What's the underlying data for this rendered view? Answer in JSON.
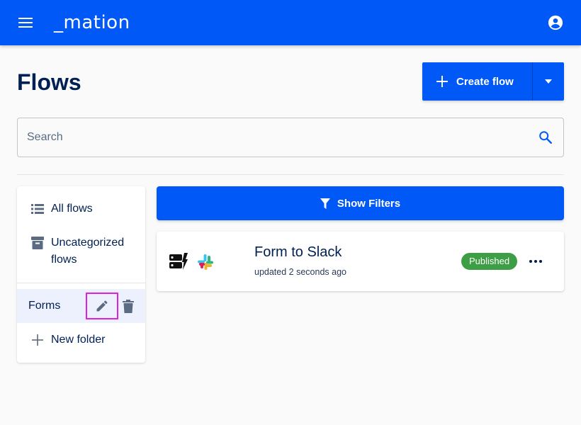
{
  "appbar": {
    "logo": "_mation"
  },
  "page": {
    "title": "Flows"
  },
  "actions": {
    "create_flow_label": "Create flow"
  },
  "search": {
    "placeholder": "Search"
  },
  "sidebar": {
    "items": [
      {
        "label": "All flows",
        "icon": "list-icon"
      },
      {
        "label": "Uncategorized flows",
        "icon": "archive-icon"
      }
    ],
    "folders": [
      {
        "label": "Forms"
      }
    ],
    "new_folder_label": "New folder"
  },
  "filters": {
    "label": "Show Filters"
  },
  "flows": [
    {
      "name": "Form to Slack",
      "updated": "updated 2 seconds ago",
      "status": "Published",
      "apps": [
        "forms-app-icon",
        "slack-icon"
      ]
    }
  ],
  "colors": {
    "primary": "#0059f7",
    "text": "#001f52",
    "published": "#3e9e45",
    "highlight": "#e020e0"
  }
}
